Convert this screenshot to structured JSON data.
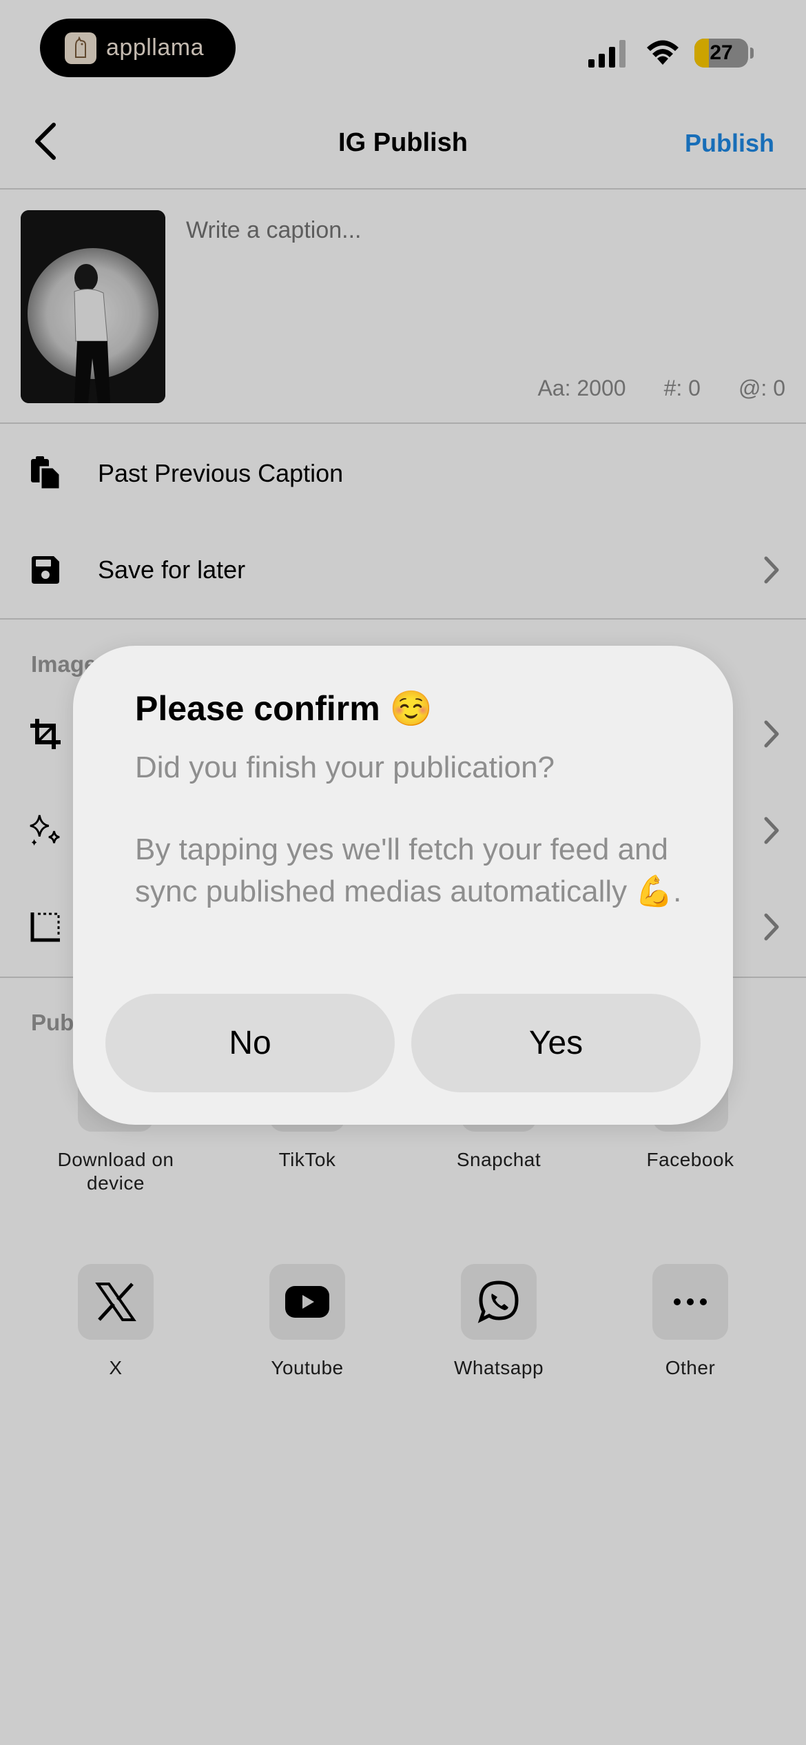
{
  "status_bar": {
    "app_name": "appllama",
    "battery": "27",
    "battery_level": 0.27
  },
  "nav": {
    "title": "IG Publish",
    "publish_label": "Publish"
  },
  "caption": {
    "placeholder": "Write a caption...",
    "char_count": "Aa: 2000",
    "hashtag_count": "#: 0",
    "mention_count": "@: 0"
  },
  "actions": [
    {
      "label": "Past Previous Caption",
      "icon": "clipboard-icon"
    },
    {
      "label": "Save for later",
      "icon": "save-icon"
    }
  ],
  "sections": {
    "image_label": "Image",
    "publish_label": "Pub"
  },
  "share_targets": [
    {
      "label": "Download on device",
      "icon": "download-icon"
    },
    {
      "label": "TikTok",
      "icon": "tiktok-icon"
    },
    {
      "label": "Snapchat",
      "icon": "snapchat-icon"
    },
    {
      "label": "Facebook",
      "icon": "facebook-icon"
    },
    {
      "label": "X",
      "icon": "x-icon"
    },
    {
      "label": "Youtube",
      "icon": "youtube-icon"
    },
    {
      "label": "Whatsapp",
      "icon": "whatsapp-icon"
    },
    {
      "label": "Other",
      "icon": "more-icon"
    }
  ],
  "dialog": {
    "title": "Please confirm ☺️",
    "message": "Did you finish your publication?",
    "detail": "By tapping yes we'll fetch your feed and sync published medias automatically 💪.",
    "no_label": "No",
    "yes_label": "Yes"
  },
  "colors": {
    "accent": "#1f8ae6",
    "overlay": "rgba(0,0,0,0.2)",
    "dialog_bg": "#efefef",
    "button_bg": "#dcdcdc"
  }
}
